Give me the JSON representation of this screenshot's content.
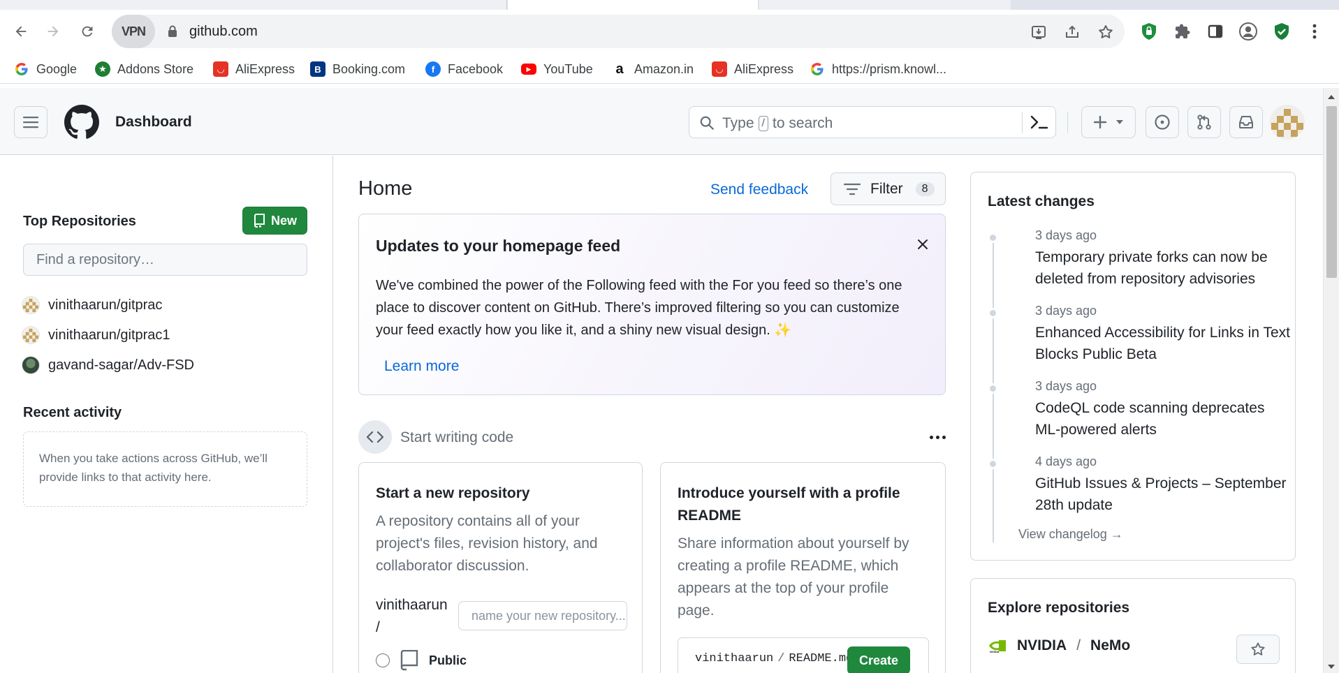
{
  "browser": {
    "url": "github.com",
    "vpn_label": "VPN",
    "bookmarks": [
      {
        "label": "Google",
        "icon": "google-icon"
      },
      {
        "label": "Addons Store",
        "icon": "addons-store-icon"
      },
      {
        "label": "AliExpress",
        "icon": "aliexpress-icon"
      },
      {
        "label": "Booking.com",
        "icon": "booking-icon"
      },
      {
        "label": "Facebook",
        "icon": "facebook-icon"
      },
      {
        "label": "YouTube",
        "icon": "youtube-icon"
      },
      {
        "label": "Amazon.in",
        "icon": "amazon-icon"
      },
      {
        "label": "AliExpress",
        "icon": "aliexpress-icon"
      },
      {
        "label": "https://prism.knowl...",
        "icon": "google-icon"
      }
    ]
  },
  "header": {
    "context": "Dashboard",
    "search_placeholder_prefix": "Type",
    "search_key": "/",
    "search_placeholder_suffix": "to search"
  },
  "sidebar": {
    "top_repos_title": "Top Repositories",
    "new_label": "New",
    "find_placeholder": "Find a repository…",
    "repos": [
      {
        "name": "vinithaarun/gitprac",
        "avatar": "identicon"
      },
      {
        "name": "vinithaarun/gitprac1",
        "avatar": "identicon"
      },
      {
        "name": "gavand-sagar/Adv-FSD",
        "avatar": "photo"
      }
    ],
    "recent_title": "Recent activity",
    "recent_empty": "When you take actions across GitHub, we’ll provide links to that activity here."
  },
  "main": {
    "title": "Home",
    "send_feedback": "Send feedback",
    "filter_label": "Filter",
    "filter_count": "8",
    "updates": {
      "title": "Updates to your homepage feed",
      "body": "We've combined the power of the Following feed with the For you feed so there’s one place to discover content on GitHub. There’s improved filtering so you can customize your feed exactly how you like it, and a shiny new visual design. ✨",
      "learn_more": "Learn more"
    },
    "start_writing": "Start writing code",
    "new_repo_card": {
      "title": "Start a new repository",
      "desc": "A repository contains all of your project's files, revision history, and collaborator discussion.",
      "owner": "vinithaarun",
      "owner_slash": "/",
      "name_placeholder": "name your new repository...",
      "visibility_public": "Public"
    },
    "readme_card": {
      "title": "Introduce yourself with a profile README",
      "desc": "Share information about yourself by creating a profile README, which appears at the top of your profile page.",
      "path_user": "vinithaarun",
      "path_sep": "/",
      "path_file": "README.md",
      "create_label": "Create"
    }
  },
  "right": {
    "latest_title": "Latest changes",
    "changes": [
      {
        "date": "3 days ago",
        "title": "Temporary private forks can now be deleted from repository advisories"
      },
      {
        "date": "3 days ago",
        "title": "Enhanced Accessibility for Links in Text Blocks Public Beta"
      },
      {
        "date": "3 days ago",
        "title": "CodeQL code scanning deprecates ML-powered alerts"
      },
      {
        "date": "4 days ago",
        "title": "GitHub Issues & Projects – September 28th update"
      }
    ],
    "view_changelog": "View changelog →",
    "explore_title": "Explore repositories",
    "explore_repo_owner": "NVIDIA",
    "explore_repo_sep": "/",
    "explore_repo_name": "NeMo"
  },
  "colors": {
    "accent_link": "#0969da",
    "primary_button": "#1f883d",
    "border": "#d0d7de",
    "muted_text": "#656d76"
  }
}
